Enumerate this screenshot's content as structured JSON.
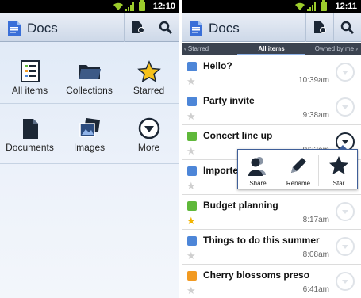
{
  "status": {
    "left_time": "12:10",
    "right_time": "12:11"
  },
  "app": {
    "title": "Docs"
  },
  "home": {
    "tiles": [
      {
        "label": "All items",
        "icon": "all-items-icon"
      },
      {
        "label": "Collections",
        "icon": "folder-icon"
      },
      {
        "label": "Starred",
        "icon": "star-icon"
      },
      {
        "label": "Documents",
        "icon": "document-icon"
      },
      {
        "label": "Images",
        "icon": "images-icon"
      },
      {
        "label": "More",
        "icon": "more-icon"
      }
    ]
  },
  "tabs": {
    "left": "‹ Starred",
    "active": "All items",
    "right": "Owned by me ›"
  },
  "docs": [
    {
      "name": "Hello?",
      "time": "10:39am",
      "type": "document",
      "starred": false
    },
    {
      "name": "Party invite",
      "time": "9:38am",
      "type": "document",
      "starred": false
    },
    {
      "name": "Concert line up",
      "time": "9:22am",
      "type": "spreadsheet",
      "starred": false
    },
    {
      "name": "Importe",
      "time": "",
      "type": "document",
      "starred": false
    },
    {
      "name": "Budget planning",
      "time": "8:17am",
      "type": "spreadsheet",
      "starred": true
    },
    {
      "name": "Things to do this summer",
      "time": "8:08am",
      "type": "document",
      "starred": false
    },
    {
      "name": "Cherry blossoms preso",
      "time": "6:41am",
      "type": "presentation",
      "starred": false
    }
  ],
  "popup": {
    "share": "Share",
    "rename": "Rename",
    "star": "Star"
  },
  "colors": {
    "document": "#4d86d8",
    "spreadsheet": "#5fb83a",
    "presentation": "#f29a21",
    "star_on": "#f2b400",
    "star_off": "#cfcfcf"
  }
}
